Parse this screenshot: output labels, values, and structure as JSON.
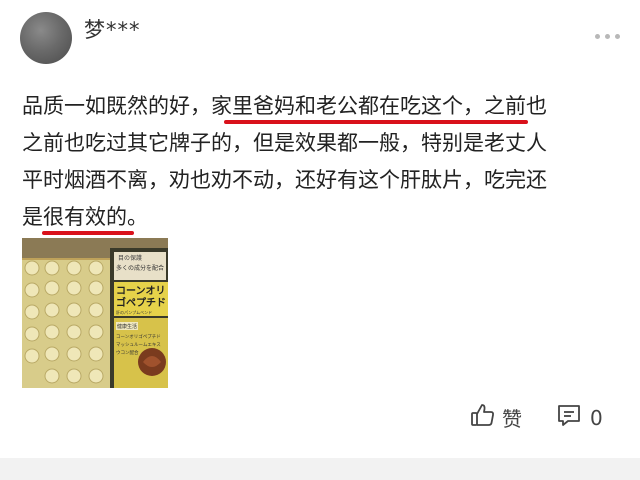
{
  "post": {
    "username": "梦***",
    "content_lines": [
      [
        "品质一如既然的好，",
        "家里爸妈和老公都在吃这个，",
        "之前也"
      ],
      [
        "之前也吃过其它牌子的，但是效果都一般，特别是老丈人"
      ],
      [
        "平时烟酒不离，劝也劝不动，还好有这个肝肽片，吃完还"
      ],
      [
        "是",
        "很有效的",
        "。"
      ]
    ],
    "highlight_color": "#d9111b",
    "photo": {
      "box_label_top": "目の保護",
      "box_label_jp1": "多くの成分を配合",
      "box_title_1": "コーンオリ",
      "box_title_2": "ゴペプチド",
      "box_small": "肝のパンプムベンド",
      "box_badge": "健康生活",
      "box_list": [
        "コーンオリゴペプチド",
        "マッシュルームエキス",
        "ウコン配合"
      ]
    }
  },
  "actions": {
    "like_icon": "thumbs-up-icon",
    "like_label": "赞",
    "comment_icon": "comment-icon",
    "comment_count": "0"
  }
}
